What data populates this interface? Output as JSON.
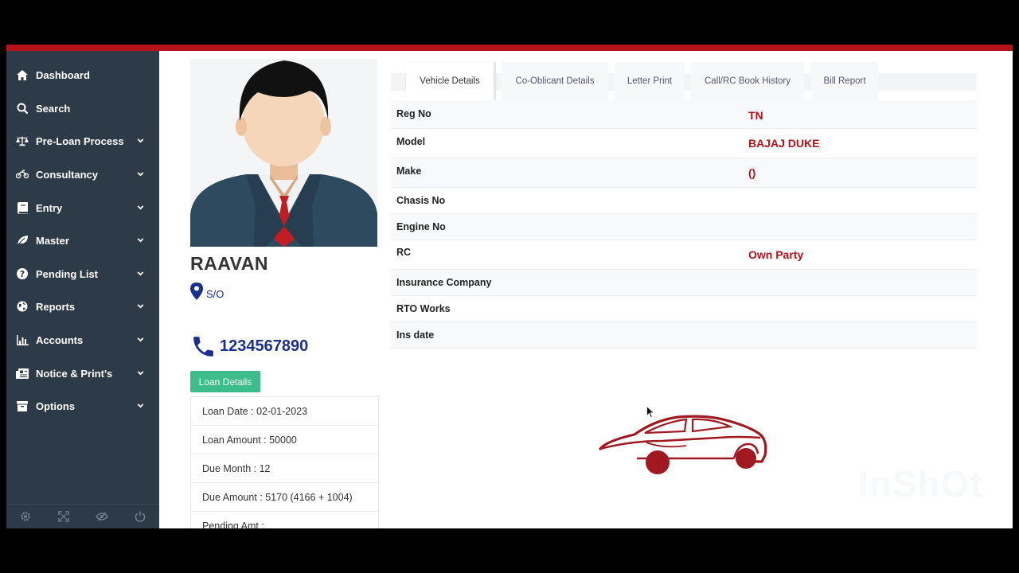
{
  "sidebar": {
    "items": [
      {
        "label": "Dashboard",
        "icon": "home-icon",
        "has_submenu": false
      },
      {
        "label": "Search",
        "icon": "search-icon",
        "has_submenu": false
      },
      {
        "label": "Pre-Loan Process",
        "icon": "scale-icon",
        "has_submenu": true
      },
      {
        "label": "Consultancy",
        "icon": "motorcycle-icon",
        "has_submenu": true
      },
      {
        "label": "Entry",
        "icon": "book-icon",
        "has_submenu": true
      },
      {
        "label": "Master",
        "icon": "leaf-icon",
        "has_submenu": true
      },
      {
        "label": "Pending List",
        "icon": "question-circle-icon",
        "has_submenu": true
      },
      {
        "label": "Reports",
        "icon": "globe-icon",
        "has_submenu": true
      },
      {
        "label": "Accounts",
        "icon": "bar-chart-icon",
        "has_submenu": true
      },
      {
        "label": "Notice & Print's",
        "icon": "newspaper-icon",
        "has_submenu": true
      },
      {
        "label": "Options",
        "icon": "archive-icon",
        "has_submenu": true
      }
    ],
    "footer_icons": [
      "settings-icon",
      "fullscreen-icon",
      "hide-icon",
      "power-icon"
    ]
  },
  "profile": {
    "name": "RAAVAN",
    "relation": "S/O",
    "phone": "1234567890",
    "loan_button": "Loan Details",
    "loan_rows": [
      "Loan Date : 02-01-2023",
      "Loan Amount : 50000",
      "Due Month : 12",
      "Due Amount : 5170 (4166 + 1004)",
      "Pending Amt :"
    ]
  },
  "tabs": [
    {
      "label": "Vehicle Details",
      "active": true
    },
    {
      "label": "Co-Oblicant Details",
      "active": false
    },
    {
      "label": "Letter Print",
      "active": false
    },
    {
      "label": "Call/RC Book History",
      "active": false
    },
    {
      "label": "Bill Report",
      "active": false
    }
  ],
  "vehicle_details": [
    {
      "label": "Reg No",
      "value": "TN"
    },
    {
      "label": "Model",
      "value": "BAJAJ DUKE"
    },
    {
      "label": "Make",
      "value": "()"
    },
    {
      "label": "Chasis No",
      "value": ""
    },
    {
      "label": "Engine No",
      "value": ""
    },
    {
      "label": "RC",
      "value": "Own Party"
    },
    {
      "label": "Insurance Company",
      "value": ""
    },
    {
      "label": "RTO Works",
      "value": ""
    },
    {
      "label": "Ins date",
      "value": ""
    }
  ],
  "watermark": "InShOt",
  "colors": {
    "sidebar_bg": "#2c3b47",
    "accent_red": "#b5121b",
    "phone_blue": "#1a2f8f",
    "button_green": "#3ebd8c"
  }
}
